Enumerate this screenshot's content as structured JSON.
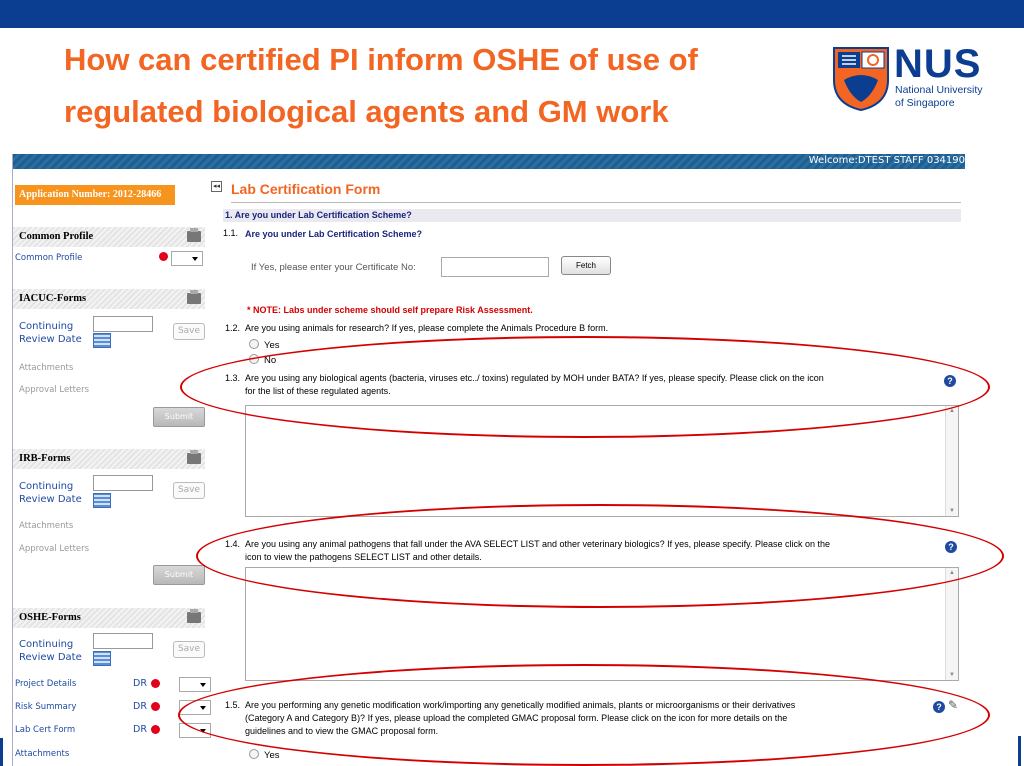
{
  "slide": {
    "title_line1": "How can certified PI inform OSHE of use of",
    "title_line2": "regulated biological agents and GM work",
    "logo": {
      "name": "NUS",
      "sub1": "National University",
      "sub2": "of Singapore"
    }
  },
  "header": {
    "welcome": "Welcome:DTEST STAFF 034190"
  },
  "sidebar": {
    "application_number": "Application Number: 2012-28466",
    "common_profile": {
      "heading": "Common Profile",
      "link": "Common Profile"
    },
    "iacuc": {
      "heading": "IACUC-Forms",
      "crd_label1": "Continuing",
      "crd_label2": "Review Date",
      "save": "Save",
      "attachments": "Attachments",
      "approval": "Approval Letters",
      "submit": "Submit"
    },
    "irb": {
      "heading": "IRB-Forms",
      "crd_label1": "Continuing",
      "crd_label2": "Review Date",
      "save": "Save",
      "attachments": "Attachments",
      "approval": "Approval Letters",
      "submit": "Submit"
    },
    "oshe": {
      "heading": "OSHE-Forms",
      "crd_label1": "Continuing",
      "crd_label2": "Review Date",
      "save": "Save",
      "items": [
        {
          "label": "Project Details",
          "status": "DR"
        },
        {
          "label": "Risk Summary",
          "status": "DR"
        },
        {
          "label": "Lab Cert Form",
          "status": "DR"
        },
        {
          "label": "Attachments",
          "status": ""
        }
      ]
    }
  },
  "form": {
    "title": "Lab Certification Form",
    "section1": "1.  Are you under Lab Certification Scheme?",
    "q1_1_num": "1.1.",
    "q1_1": "Are you under Lab Certification Scheme?",
    "cert_label": "If Yes, please enter your Certificate No:",
    "cert_value": "",
    "fetch": "Fetch",
    "note": "* NOTE: Labs under scheme should self prepare Risk Assessment.",
    "q1_2_num": "1.2.",
    "q1_2": "Are you using animals for research? If yes, please complete the Animals Procedure B form.",
    "yes": "Yes",
    "no": "No",
    "q1_3_num": "1.3.",
    "q1_3a": "Are you using any biological agents (bacteria, viruses etc../ toxins) regulated by MOH under BATA? If yes, please specify. Please click on the icon",
    "q1_3b": "for the list of these regulated agents.",
    "q1_4_num": "1.4.",
    "q1_4a": "Are you using any animal pathogens that fall under the AVA SELECT LIST and other veterinary biologics? If yes, please specify. Please click on the",
    "q1_4b": "icon to view the pathogens SELECT LIST and other details.",
    "q1_5_num": "1.5.",
    "q1_5a": "Are you performing any genetic modification work/importing any genetically modified animals, plants or microorganisms or their derivatives",
    "q1_5b": "(Category A and Category B)? If yes, please upload the completed GMAC proposal form. Please click on the icon for more details on the",
    "q1_5c": "guidelines and to view the GMAC proposal form.",
    "help_glyph": "?"
  },
  "colors": {
    "accent": "#f26522",
    "brand": "#0b3d91",
    "highlight": "#d40000"
  },
  "icons": [
    "printer-icon",
    "calendar-icon",
    "help-icon",
    "paperclip-icon",
    "red-status-dot",
    "collapse-icon",
    "dropdown-chevron-icon"
  ]
}
